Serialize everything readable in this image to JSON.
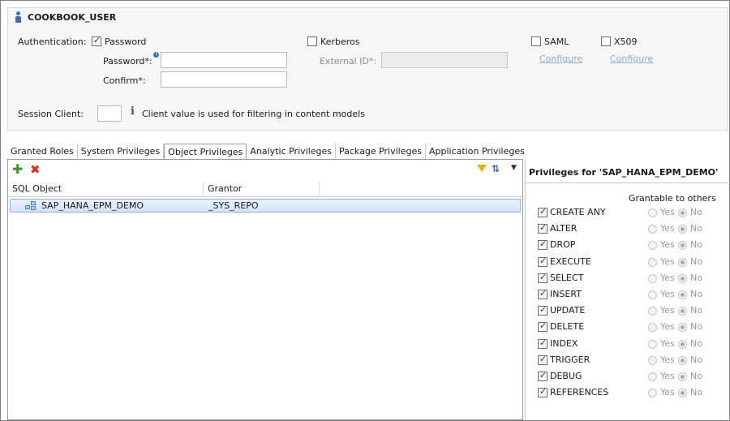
{
  "user": {
    "name": "COOKBOOK_USER"
  },
  "auth": {
    "label": "Authentication:",
    "password": {
      "label": "Password",
      "checked": true
    },
    "password_field_label": "Password*:",
    "password_value": "",
    "confirm_label": "Confirm*:",
    "confirm_value": "",
    "kerberos": {
      "label": "Kerberos",
      "checked": false
    },
    "external_id_label": "External ID*:",
    "external_id_value": "",
    "saml": {
      "label": "SAML",
      "checked": false,
      "link": "Configure"
    },
    "x509": {
      "label": "X509",
      "checked": false,
      "link": "Configure"
    }
  },
  "session": {
    "label": "Session Client:",
    "value": "",
    "hint": "Client value is used for filtering in content models"
  },
  "tabs": [
    {
      "label": "Granted Roles",
      "active": false
    },
    {
      "label": "System Privileges",
      "active": false
    },
    {
      "label": "Object Privileges",
      "active": true
    },
    {
      "label": "Analytic Privileges",
      "active": false
    },
    {
      "label": "Package Privileges",
      "active": false
    },
    {
      "label": "Application Privileges",
      "active": false
    }
  ],
  "table": {
    "columns": [
      "SQL Object",
      "Grantor"
    ],
    "rows": [
      {
        "object": "SAP_HANA_EPM_DEMO",
        "grantor": "_SYS_REPO",
        "selected": true
      }
    ]
  },
  "privileges_panel": {
    "title": "Privileges for 'SAP_HANA_EPM_DEMO'",
    "grantable_header": "Grantable to others",
    "yes_label": "Yes",
    "no_label": "No",
    "items": [
      {
        "name": "CREATE ANY",
        "checked": true,
        "grantable": "No"
      },
      {
        "name": "ALTER",
        "checked": true,
        "grantable": "No"
      },
      {
        "name": "DROP",
        "checked": true,
        "grantable": "No"
      },
      {
        "name": "EXECUTE",
        "checked": true,
        "grantable": "No"
      },
      {
        "name": "SELECT",
        "checked": true,
        "grantable": "No"
      },
      {
        "name": "INSERT",
        "checked": true,
        "grantable": "No"
      },
      {
        "name": "UPDATE",
        "checked": true,
        "grantable": "No"
      },
      {
        "name": "DELETE",
        "checked": true,
        "grantable": "No"
      },
      {
        "name": "INDEX",
        "checked": true,
        "grantable": "No"
      },
      {
        "name": "TRIGGER",
        "checked": true,
        "grantable": "No"
      },
      {
        "name": "DEBUG",
        "checked": true,
        "grantable": "No"
      },
      {
        "name": "REFERENCES",
        "checked": true,
        "grantable": "No"
      }
    ]
  },
  "colors": {
    "accent": "#3d6fb5",
    "add": "#3c9a2c",
    "remove": "#d8301e",
    "selection": "#d4e4f7"
  }
}
